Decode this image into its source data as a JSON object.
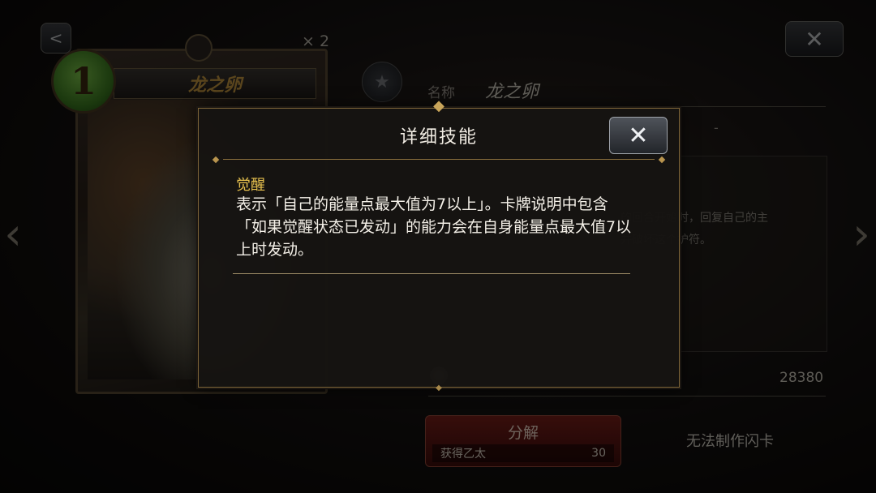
{
  "card": {
    "cost": "1",
    "name": "龙之卵",
    "copies": "× 2"
  },
  "info": {
    "name_label": "名称",
    "name_value": "龙之卵",
    "row2_value": "-",
    "desc_tail_1": "的回合开始时，回复自己的主",
    "desc_tail_2": "并破坏这个护符。",
    "ether_value": "28380"
  },
  "actions": {
    "dismantle_label": "分解",
    "dismantle_sub_label": "获得乙太",
    "dismantle_sub_value": "30",
    "flash_label": "无法制作闪卡"
  },
  "modal": {
    "title": "详细技能",
    "skill_name": "觉醒",
    "skill_description": "表示「自己的能量点最大值为7以上」。卡牌说明中包含「如果觉醒状态已发动」的能力会在自身能量点最大值7以上时发动。"
  },
  "colors": {
    "accent_gold": "#e6c04e",
    "frame_gold": "#7d6438",
    "dismantle_red": "#7a1f1a",
    "cost_green": "#5aa534"
  },
  "icons": {
    "share": "share-icon",
    "close": "close-icon",
    "star": "star-icon",
    "ether": "ether-icon",
    "left": "chevron-left-icon",
    "right": "chevron-right-icon"
  }
}
